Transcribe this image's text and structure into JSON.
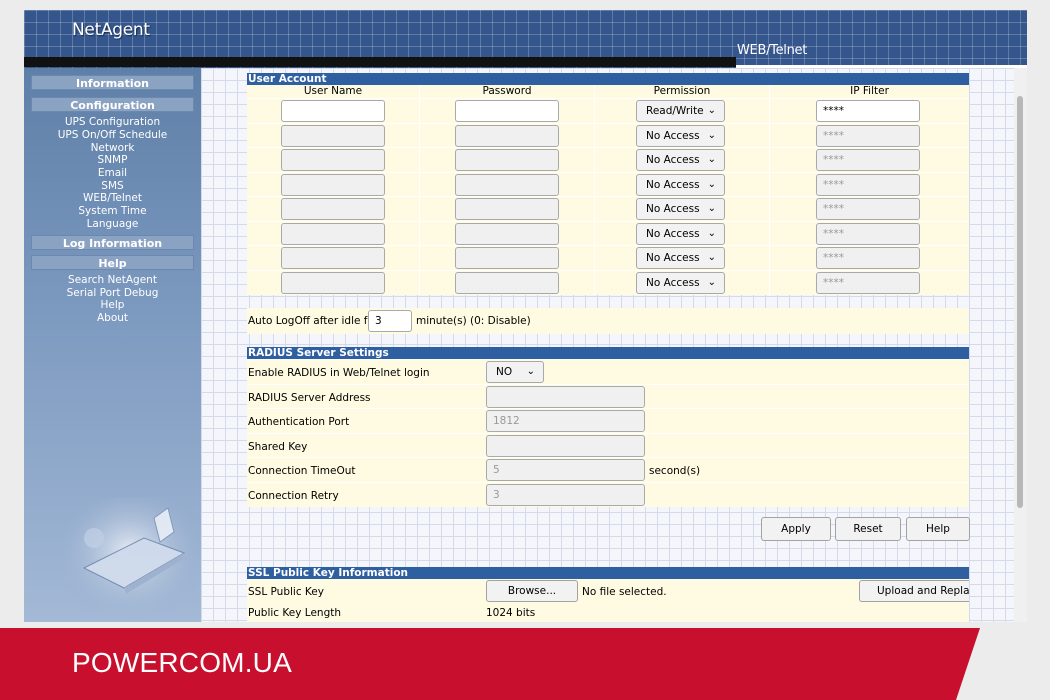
{
  "header": {
    "logo": "NetAgent",
    "subtitle": "WEB/Telnet"
  },
  "sidebar": {
    "information": "Information",
    "configuration": "Configuration",
    "config_items": [
      "UPS Configuration",
      "UPS On/Off Schedule",
      "Network",
      "SNMP",
      "Email",
      "SMS",
      "WEB/Telnet",
      "System Time",
      "Language"
    ],
    "log_information": "Log Information",
    "help": "Help",
    "help_items": [
      "Search NetAgent",
      "Serial Port Debug",
      "Help",
      "About"
    ]
  },
  "user_account": {
    "title": "User Account",
    "columns": [
      "User Name",
      "Password",
      "Permission",
      "IP Filter"
    ],
    "rows": [
      {
        "user": "",
        "password": "",
        "permission": "Read/Write",
        "ip_filter": "****"
      },
      {
        "user": "",
        "password": "",
        "permission": "No Access",
        "ip_filter": "****"
      },
      {
        "user": "",
        "password": "",
        "permission": "No Access",
        "ip_filter": "****"
      },
      {
        "user": "",
        "password": "",
        "permission": "No Access",
        "ip_filter": "****"
      },
      {
        "user": "",
        "password": "",
        "permission": "No Access",
        "ip_filter": "****"
      },
      {
        "user": "",
        "password": "",
        "permission": "No Access",
        "ip_filter": "****"
      },
      {
        "user": "",
        "password": "",
        "permission": "No Access",
        "ip_filter": "****"
      },
      {
        "user": "",
        "password": "",
        "permission": "No Access",
        "ip_filter": "****"
      }
    ],
    "auto_logoff_label": "Auto LogOff after idle for",
    "auto_logoff_value": "3",
    "auto_logoff_suffix": "minute(s) (0: Disable)"
  },
  "radius": {
    "title": "RADIUS Server Settings",
    "enable_label": "Enable RADIUS in Web/Telnet login",
    "enable_value": "NO",
    "server_label": "RADIUS Server Address",
    "server_value": "",
    "auth_port_label": "Authentication Port",
    "auth_port_value": "1812",
    "shared_key_label": "Shared Key",
    "shared_key_value": "",
    "timeout_label": "Connection TimeOut",
    "timeout_value": "5",
    "timeout_suffix": "second(s)",
    "retry_label": "Connection Retry",
    "retry_value": "3"
  },
  "actions": {
    "apply": "Apply",
    "reset": "Reset",
    "help": "Help"
  },
  "ssl": {
    "title": "SSL Public Key Information",
    "key_label": "SSL Public Key",
    "browse": "Browse...",
    "file_status": "No file selected.",
    "upload": "Upload and Replac",
    "length_label": "Public Key Length",
    "length_value": "1024 bits"
  },
  "brand": "POWERCOM.UA",
  "colors": {
    "section_header": "#2e5fa1",
    "panel": "#fffbe2",
    "header": "#34568c",
    "brand_red": "#c8102e"
  }
}
